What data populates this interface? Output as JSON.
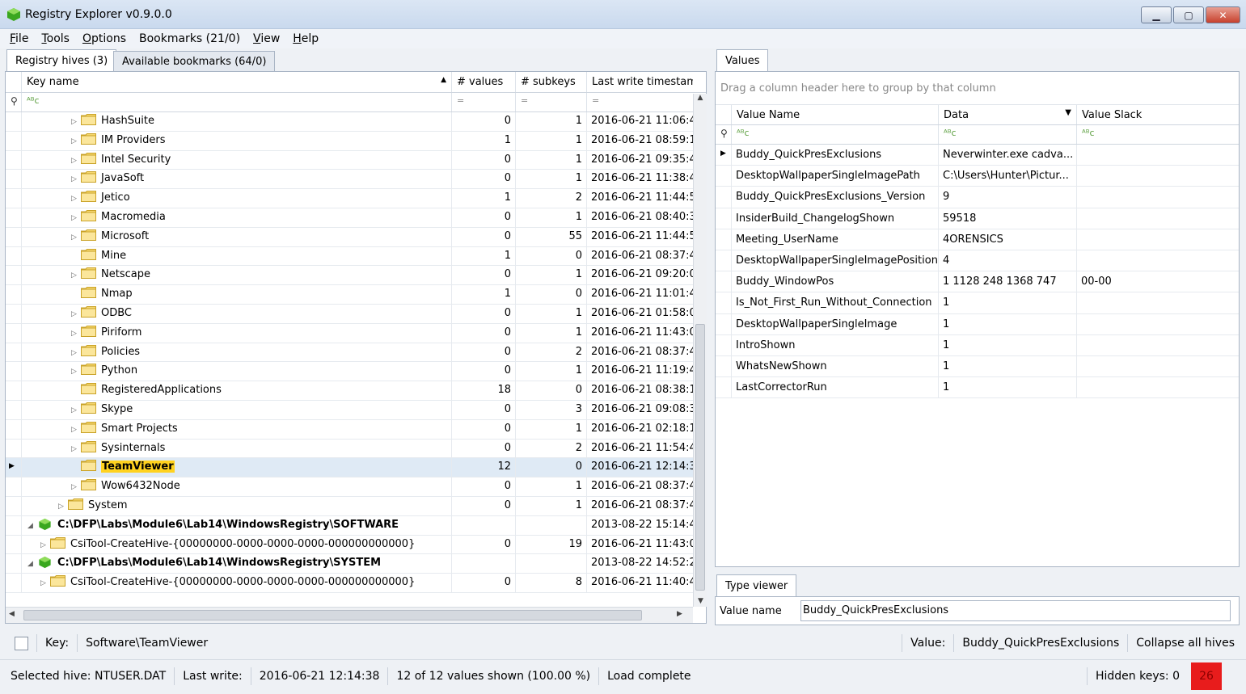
{
  "window": {
    "title": "Registry Explorer v0.9.0.0"
  },
  "menu": [
    {
      "hot": "F",
      "rest": "ile"
    },
    {
      "hot": "T",
      "rest": "ools"
    },
    {
      "hot": "O",
      "rest": "ptions"
    },
    {
      "hot": "",
      "rest": "Bookmarks (21/0)"
    },
    {
      "hot": "V",
      "rest": "iew"
    },
    {
      "hot": "H",
      "rest": "elp"
    }
  ],
  "left_tabs": {
    "hives": "Registry hives (3)",
    "bookmarks": "Available bookmarks (64/0)"
  },
  "tree": {
    "columns": {
      "key": "Key name",
      "values": "# values",
      "subkeys": "# subkeys",
      "timestamp": "Last write timestamp"
    },
    "filter_eq": "=",
    "rows": [
      {
        "name": "HashSuite",
        "values": "0",
        "subkeys": "1",
        "ts": "2016-06-21 11:06:4",
        "expander": "▷"
      },
      {
        "name": "IM Providers",
        "values": "1",
        "subkeys": "1",
        "ts": "2016-06-21 08:59:1",
        "expander": "▷"
      },
      {
        "name": "Intel Security",
        "values": "0",
        "subkeys": "1",
        "ts": "2016-06-21 09:35:4",
        "expander": "▷"
      },
      {
        "name": "JavaSoft",
        "values": "0",
        "subkeys": "1",
        "ts": "2016-06-21 11:38:4",
        "expander": "▷"
      },
      {
        "name": "Jetico",
        "values": "1",
        "subkeys": "2",
        "ts": "2016-06-21 11:44:5",
        "expander": "▷"
      },
      {
        "name": "Macromedia",
        "values": "0",
        "subkeys": "1",
        "ts": "2016-06-21 08:40:3",
        "expander": "▷"
      },
      {
        "name": "Microsoft",
        "values": "0",
        "subkeys": "55",
        "ts": "2016-06-21 11:44:5",
        "expander": "▷"
      },
      {
        "name": "Mine",
        "values": "1",
        "subkeys": "0",
        "ts": "2016-06-21 08:37:4",
        "expander": ""
      },
      {
        "name": "Netscape",
        "values": "0",
        "subkeys": "1",
        "ts": "2016-06-21 09:20:0",
        "expander": "▷"
      },
      {
        "name": "Nmap",
        "values": "1",
        "subkeys": "0",
        "ts": "2016-06-21 11:01:4",
        "expander": ""
      },
      {
        "name": "ODBC",
        "values": "0",
        "subkeys": "1",
        "ts": "2016-06-21 01:58:0",
        "expander": "▷"
      },
      {
        "name": "Piriform",
        "values": "0",
        "subkeys": "1",
        "ts": "2016-06-21 11:43:0",
        "expander": "▷"
      },
      {
        "name": "Policies",
        "values": "0",
        "subkeys": "2",
        "ts": "2016-06-21 08:37:4",
        "expander": "▷"
      },
      {
        "name": "Python",
        "values": "0",
        "subkeys": "1",
        "ts": "2016-06-21 11:19:4",
        "expander": "▷"
      },
      {
        "name": "RegisteredApplications",
        "values": "18",
        "subkeys": "0",
        "ts": "2016-06-21 08:38:1",
        "expander": ""
      },
      {
        "name": "Skype",
        "values": "0",
        "subkeys": "3",
        "ts": "2016-06-21 09:08:3",
        "expander": "▷"
      },
      {
        "name": "Smart Projects",
        "values": "0",
        "subkeys": "1",
        "ts": "2016-06-21 02:18:1",
        "expander": "▷"
      },
      {
        "name": "Sysinternals",
        "values": "0",
        "subkeys": "2",
        "ts": "2016-06-21 11:54:4",
        "expander": "▷"
      },
      {
        "name": "TeamViewer",
        "values": "12",
        "subkeys": "0",
        "ts": "2016-06-21 12:14:3",
        "expander": ""
      },
      {
        "name": "Wow6432Node",
        "values": "0",
        "subkeys": "1",
        "ts": "2016-06-21 08:37:4",
        "expander": "▷"
      },
      {
        "name": "System",
        "values": "0",
        "subkeys": "1",
        "ts": "2016-06-21 08:37:4",
        "expander": "▷"
      },
      {
        "name": "C:\\DFP\\Labs\\Module6\\Lab14\\WindowsRegistry\\SOFTWARE",
        "values": "",
        "subkeys": "",
        "ts": "2013-08-22 15:14:4",
        "expander": "◢"
      },
      {
        "name": "CsiTool-CreateHive-{00000000-0000-0000-0000-000000000000}",
        "values": "0",
        "subkeys": "19",
        "ts": "2016-06-21 11:43:0",
        "expander": "▷"
      },
      {
        "name": "C:\\DFP\\Labs\\Module6\\Lab14\\WindowsRegistry\\SYSTEM",
        "values": "",
        "subkeys": "",
        "ts": "2013-08-22 14:52:2",
        "expander": "◢"
      },
      {
        "name": "CsiTool-CreateHive-{00000000-0000-0000-0000-000000000000}",
        "values": "0",
        "subkeys": "8",
        "ts": "2016-06-21 11:40:4",
        "expander": "▷"
      }
    ]
  },
  "values_tab": "Values",
  "values_panel": {
    "group_hint": "Drag a column header here to group by that column",
    "columns": {
      "name": "Value Name",
      "data": "Data",
      "slack": "Value Slack"
    },
    "rows": [
      {
        "name": "Buddy_QuickPresExclusions",
        "data": "Neverwinter.exe cadva...",
        "slack": ""
      },
      {
        "name": "DesktopWallpaperSingleImagePath",
        "data": "C:\\Users\\Hunter\\Pictur...",
        "slack": ""
      },
      {
        "name": "Buddy_QuickPresExclusions_Version",
        "data": "9",
        "slack": ""
      },
      {
        "name": "InsiderBuild_ChangelogShown",
        "data": "59518",
        "slack": ""
      },
      {
        "name": "Meeting_UserName",
        "data": "4ORENSICS",
        "slack": ""
      },
      {
        "name": "DesktopWallpaperSingleImagePosition",
        "data": "4",
        "slack": ""
      },
      {
        "name": "Buddy_WindowPos",
        "data": "1 1128 248 1368 747",
        "slack": "00-00"
      },
      {
        "name": "Is_Not_First_Run_Without_Connection",
        "data": "1",
        "slack": ""
      },
      {
        "name": "DesktopWallpaperSingleImage",
        "data": "1",
        "slack": ""
      },
      {
        "name": "IntroShown",
        "data": "1",
        "slack": ""
      },
      {
        "name": "WhatsNewShown",
        "data": "1",
        "slack": ""
      },
      {
        "name": "LastCorrectorRun",
        "data": "1",
        "slack": ""
      }
    ]
  },
  "type_viewer": {
    "tab": "Type viewer",
    "label": "Value name",
    "value": "Buddy_QuickPresExclusions"
  },
  "keybar": {
    "key_label": "Key:",
    "key_value": "Software\\TeamViewer",
    "value_label": "Value:",
    "value_value": "Buddy_QuickPresExclusions",
    "collapse": "Collapse all hives"
  },
  "status": {
    "hive": "Selected hive: NTUSER.DAT",
    "last_write_label": "Last write:",
    "last_write": "2016-06-21 12:14:38",
    "shown": "12 of 12 values shown (100.00 %)",
    "load": "Load complete",
    "hidden": "Hidden keys: 0",
    "count": "26"
  },
  "colors": {
    "highlight": "#ffd21f",
    "hive_green": "#3aa71f",
    "folder": "#f5d76e",
    "status_red": "#e81c1c"
  }
}
